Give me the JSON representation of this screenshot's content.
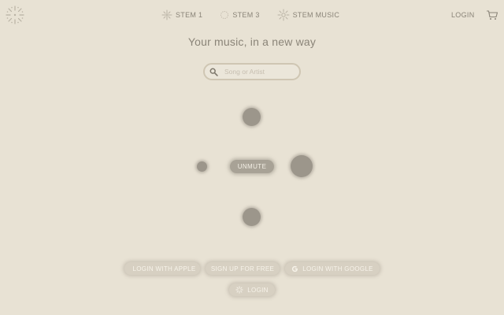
{
  "header": {
    "logo_icon": "starburst-logo-icon",
    "nav": [
      {
        "label": "STEM 1",
        "icon": "sparkle-icon"
      },
      {
        "label": "STEM 3",
        "icon": "ring-icon"
      },
      {
        "label": "STEM MUSIC",
        "icon": "sun-icon"
      }
    ],
    "login_label": "LOGIN",
    "cart_icon": "cart-icon"
  },
  "main": {
    "headline": "Your music, in a new way",
    "search": {
      "placeholder": "Song or Artist",
      "value": "",
      "icon": "search-icon"
    },
    "unmute_label": "UNMUTE"
  },
  "auth": {
    "apple_label": "LOGIN WITH APPLE",
    "signup_label": "SIGN UP FOR FREE",
    "google_label": "LOGIN WITH GOOGLE",
    "login_label": "LOGIN"
  },
  "colors": {
    "background": "#e8e2d4",
    "text": "#8a8478",
    "dot": "#9c968b",
    "button": "#d7d0c2"
  }
}
